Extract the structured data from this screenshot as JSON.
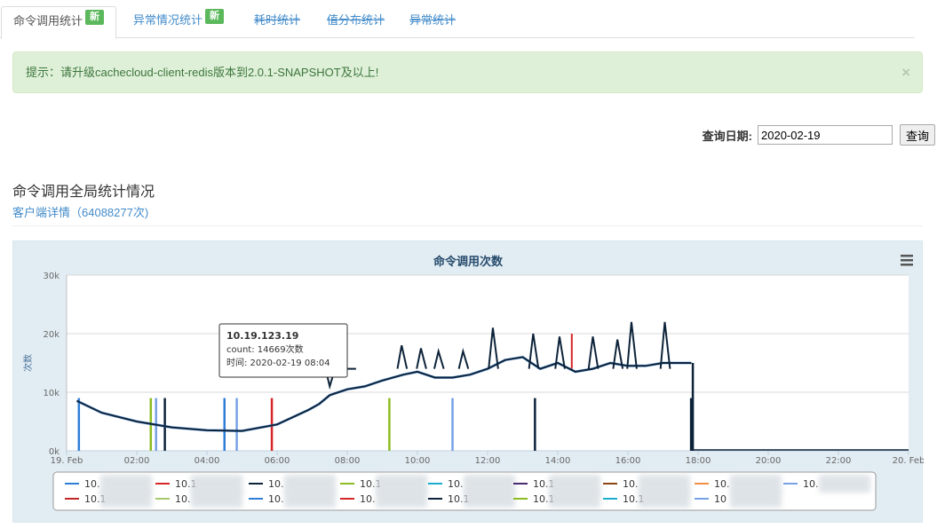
{
  "tabs": [
    {
      "label": "命令调用统计",
      "badge": "新",
      "active": true,
      "strike": false
    },
    {
      "label": "异常情况统计",
      "badge": "新",
      "active": false,
      "strike": false
    },
    {
      "label": "耗时统计",
      "badge": "",
      "active": false,
      "strike": true
    },
    {
      "label": "值分布统计",
      "badge": "",
      "active": false,
      "strike": true
    },
    {
      "label": "异常统计",
      "badge": "",
      "active": false,
      "strike": true
    }
  ],
  "alert": {
    "text": "提示：请升级cachecloud-client-redis版本到2.0.1-SNAPSHOT及以上!",
    "close": "×"
  },
  "query": {
    "label": "查询日期:",
    "date_value": "2020-02-19",
    "button": "查询"
  },
  "section": {
    "title": "命令调用全局统计情况",
    "link": "客户端详情（64088277次)"
  },
  "chart_data": {
    "type": "line",
    "title": "命令调用次数",
    "ylabel": "次数",
    "ylim": [
      0,
      30000
    ],
    "y_ticks": [
      "0k",
      "10k",
      "20k",
      "30k"
    ],
    "x_ticks": [
      "19. Feb",
      "02:00",
      "04:00",
      "06:00",
      "08:00",
      "10:00",
      "12:00",
      "14:00",
      "16:00",
      "18:00",
      "20:00",
      "22:00",
      "20. Feb"
    ],
    "x_unit": "hours",
    "series": [
      {
        "color": "#0d233a",
        "x": [
          0.3,
          1.0,
          2.0,
          3.0,
          4.0,
          5.0,
          6.0,
          6.9,
          7.2,
          7.5,
          8.0,
          8.5,
          9.0,
          9.6,
          10.0,
          10.5,
          11.0,
          11.5,
          12.0,
          12.5,
          13.0,
          13.5,
          14.0,
          14.5,
          15.0,
          15.5,
          16.0,
          16.5,
          17.0,
          17.5,
          17.8
        ],
        "values": [
          8500,
          6500,
          5000,
          4000,
          3500,
          3400,
          4500,
          7000,
          8000,
          9500,
          10500,
          11000,
          12000,
          13000,
          13500,
          12500,
          12500,
          13000,
          14000,
          15500,
          16000,
          14000,
          15000,
          13500,
          14000,
          15000,
          14500,
          14500,
          15000,
          15000,
          15000
        ]
      }
    ],
    "tooltip": {
      "title": "10.19.123.19",
      "line1": "count: 14669次数",
      "line2": "时间: 2020-02-19 08:04"
    },
    "legend_items": [
      "10.",
      "10.1",
      "10.",
      "10.1",
      "10.",
      "10.1",
      "10.",
      "10.",
      "10.",
      "10.1",
      "10.",
      "10.",
      "10.",
      "10.1",
      "10.1",
      "10.1",
      "10"
    ],
    "legend_colors": [
      "#2f7ed8",
      "#d62728",
      "#0d233a",
      "#8bbc21",
      "#1aadce",
      "#492970",
      "#8b4513",
      "#f28f43",
      "#77a1e5",
      "#c42525",
      "#a6c96a",
      "#2f7ed8",
      "#d62728",
      "#0d233a",
      "#8bbc21",
      "#1aadce",
      "#77a1e5"
    ],
    "grid": true,
    "legend_position": "bottom"
  }
}
